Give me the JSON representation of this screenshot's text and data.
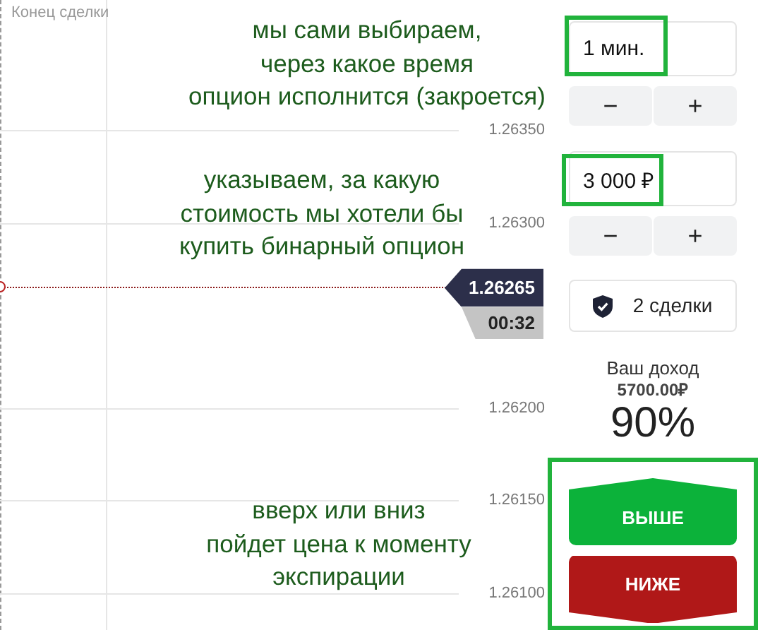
{
  "chart": {
    "deal_end_label": "Конец сделки",
    "price_levels": [
      "1.26350",
      "1.26300",
      "1.26200",
      "1.26150",
      "1.26100"
    ],
    "current_price": "1.26265",
    "timer": "00:32"
  },
  "annotations": [
    {
      "text": "мы сами выбираем,\nчерез какое время\nопцион исполнится (закроется)"
    },
    {
      "text": "указываем, за какую\nстоимость мы хотели бы\nкупить бинарный опцион"
    },
    {
      "text": "вверх или вниз\nпойдет цена к моменту\nэкспирации"
    }
  ],
  "panel": {
    "expiry": {
      "value": "1 мин.",
      "highlighted": true
    },
    "expiry_buttons": [
      "−",
      "+"
    ],
    "amount": {
      "value": "3 000 ₽",
      "highlighted": true
    },
    "amount_buttons": [
      "−",
      "+"
    ],
    "deals_button": "2 сделки",
    "income_label": "Ваш доход",
    "income_amount": "5700.00₽",
    "payout": "90%",
    "trade_buttons_highlighted": true,
    "trade_buttons": [
      {
        "label": "ВЫШЕ",
        "kind": "up"
      },
      {
        "label": "НИЖЕ",
        "kind": "down"
      }
    ]
  }
}
